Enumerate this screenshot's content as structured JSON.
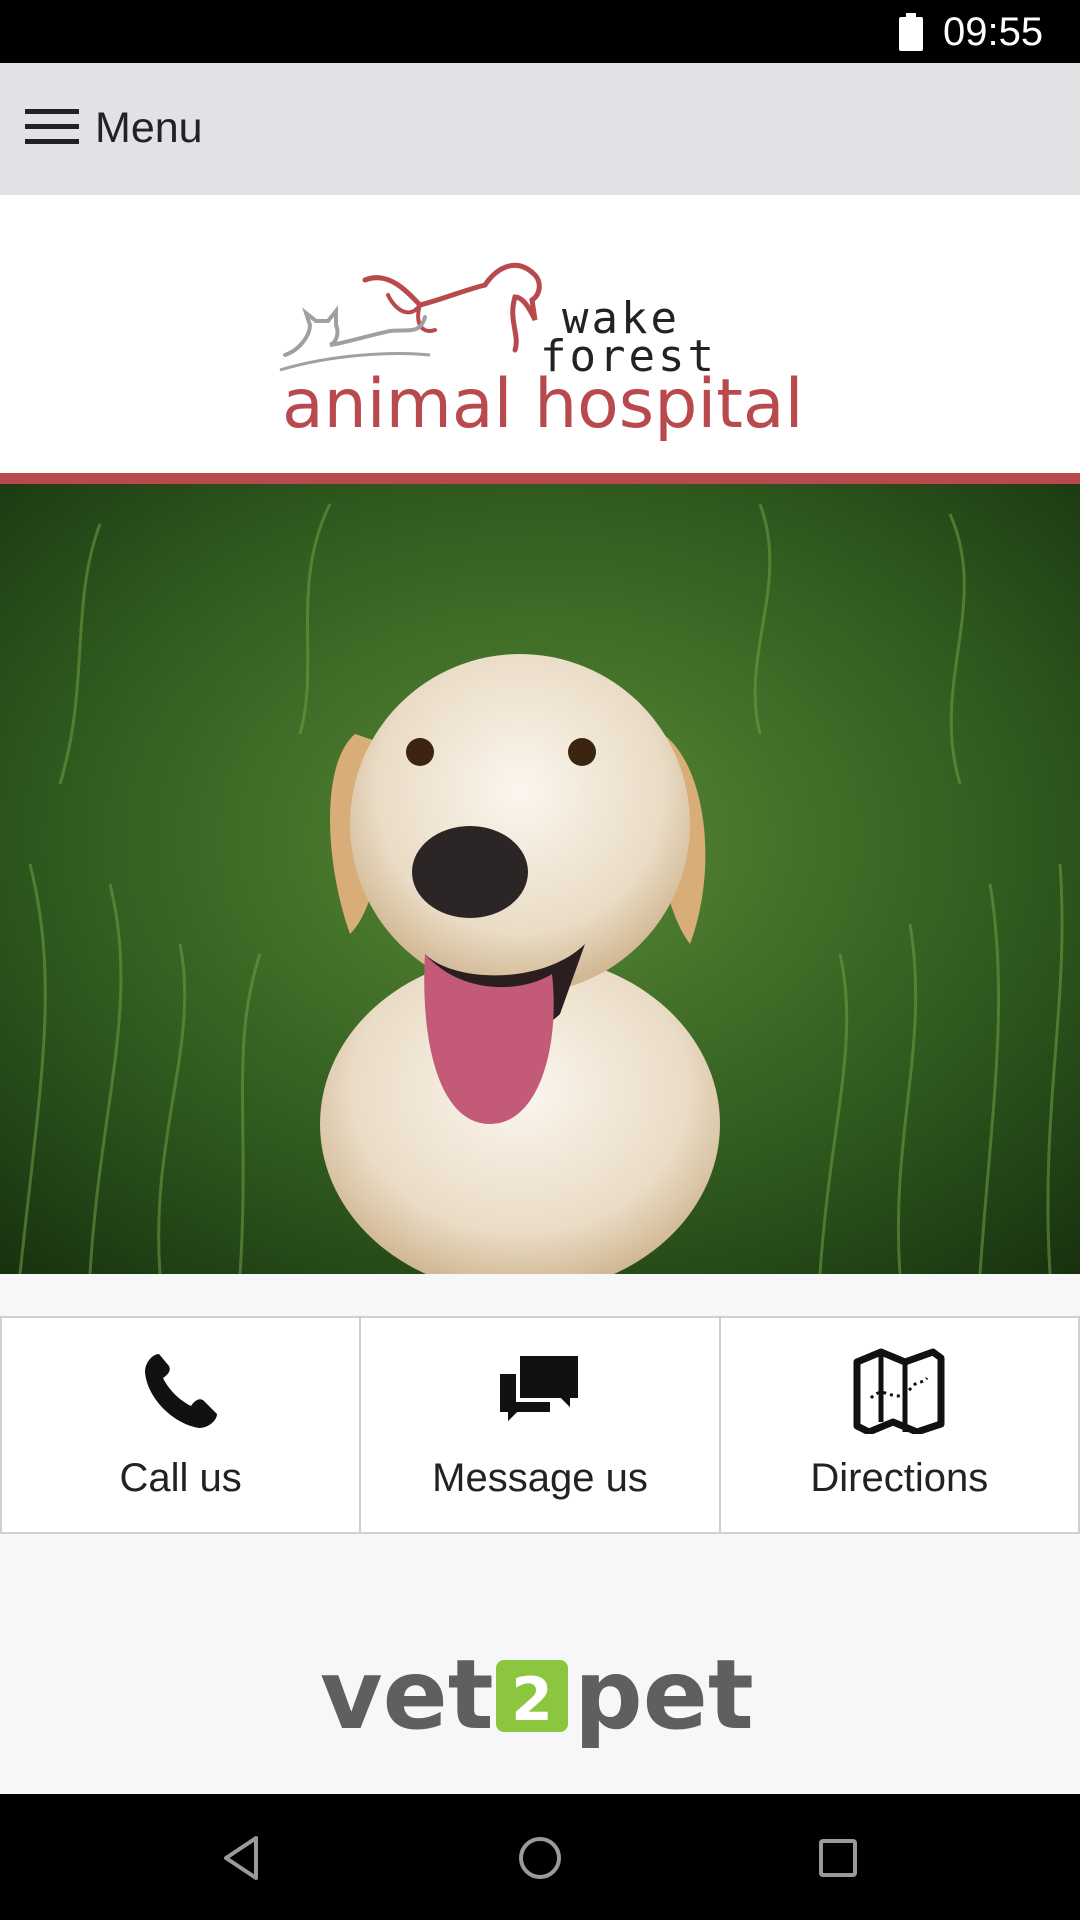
{
  "status_bar": {
    "time": "09:55",
    "battery_icon": "battery-icon"
  },
  "header": {
    "menu_label": "Menu",
    "menu_icon": "hamburger-icon"
  },
  "logo": {
    "word_wake": "wake",
    "word_forest": "forest",
    "word_animal_hospital": "animal hospital",
    "brand_color": "#b84a4e"
  },
  "actions": [
    {
      "label": "Call us",
      "icon": "phone-icon"
    },
    {
      "label": "Message us",
      "icon": "chat-bubbles-icon"
    },
    {
      "label": "Directions",
      "icon": "map-icon"
    }
  ],
  "footer": {
    "vet_text": "vet",
    "two_text": "2",
    "pet_text": "pet",
    "accent": "#8cc63f"
  },
  "nav": {
    "back_icon": "back-icon",
    "home_icon": "home-icon",
    "recents_icon": "recents-icon"
  }
}
